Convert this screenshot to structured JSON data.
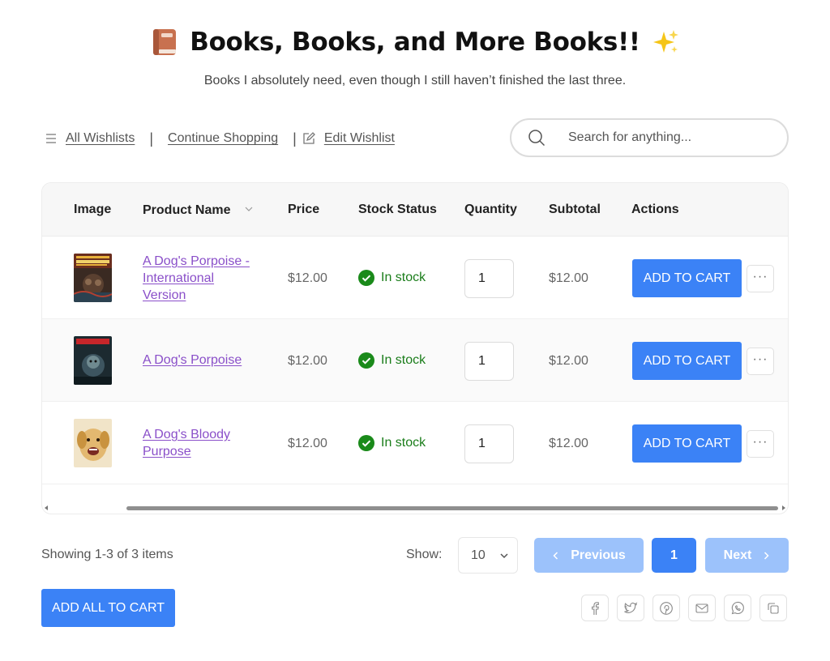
{
  "header": {
    "title": "Books, Books, and More Books!!",
    "subtitle": "Books I absolutely need, even though I still haven’t finished the last three."
  },
  "toolbar": {
    "all_wishlists": "All Wishlists",
    "continue_shopping": "Continue Shopping",
    "edit_wishlist": "Edit Wishlist"
  },
  "search": {
    "placeholder": "Search for anything..."
  },
  "table": {
    "columns": [
      "Image",
      "Product Name",
      "Price",
      "Stock Status",
      "Quantity",
      "Subtotal",
      "Actions"
    ],
    "rows": [
      {
        "name_lines": [
          "A Dog's Porpoise -",
          "International",
          "Version"
        ],
        "price": "$12.00",
        "stock": "In stock",
        "quantity": "1",
        "subtotal": "$12.00",
        "action": "ADD TO CART",
        "more": "···"
      },
      {
        "name_lines": [
          "A Dog's Porpoise"
        ],
        "price": "$12.00",
        "stock": "In stock",
        "quantity": "1",
        "subtotal": "$12.00",
        "action": "ADD TO CART",
        "more": "···"
      },
      {
        "name_lines": [
          "A Dog's Bloody",
          "Purpose"
        ],
        "price": "$12.00",
        "stock": "In stock",
        "quantity": "1",
        "subtotal": "$12.00",
        "action": "ADD TO CART",
        "more": "···"
      }
    ]
  },
  "footer": {
    "showing": "Showing 1-3 of 3 items",
    "show_label": "Show:",
    "page_size": "10",
    "previous": "Previous",
    "current_page": "1",
    "next": "Next",
    "add_all": "ADD ALL TO CART",
    "share_icons": [
      "facebook-icon",
      "twitter-icon",
      "pinterest-icon",
      "email-icon",
      "whatsapp-icon",
      "copy-icon"
    ]
  },
  "colors": {
    "primary": "#3b82f6",
    "primary_disabled": "#9cc2fb",
    "link": "#8a4fc9",
    "in_stock": "#1a7d1a"
  }
}
